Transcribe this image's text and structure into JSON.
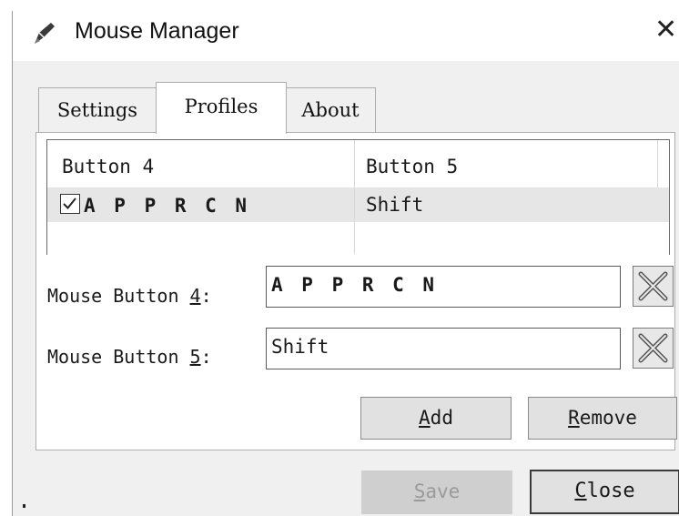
{
  "window": {
    "title": "Mouse Manager",
    "close_glyph": "✕",
    "icon": "pen-icon"
  },
  "tabs": [
    {
      "label": "Settings"
    },
    {
      "label": "Profiles",
      "selected": true
    },
    {
      "label": "About"
    }
  ],
  "profiles_list": {
    "columns": [
      "Button 4",
      "Button 5"
    ],
    "rows": [
      {
        "checked": true,
        "button4": "A P P R C N",
        "button5": "Shift"
      }
    ]
  },
  "form": {
    "mouse_button_4": {
      "label_prefix": "Mouse Button ",
      "mnemonic": "4",
      "label_suffix": ":",
      "value": "A P P R C N"
    },
    "mouse_button_5": {
      "label_prefix": "Mouse Button ",
      "mnemonic": "5",
      "label_suffix": ":",
      "value": "Shift"
    },
    "clear_icon": "clear-x-icon"
  },
  "buttons": {
    "add": {
      "mnemonic": "A",
      "rest": "dd"
    },
    "remove": {
      "mnemonic": "R",
      "rest": "emove"
    },
    "save": {
      "mnemonic": "S",
      "rest": "ave",
      "enabled": false
    },
    "close": {
      "mnemonic": "C",
      "rest": "lose"
    }
  },
  "colors": {
    "dialog_background": "#f0f0f0",
    "selected_row": "#e6e6e6",
    "disabled_button": "#cfcfcf"
  }
}
